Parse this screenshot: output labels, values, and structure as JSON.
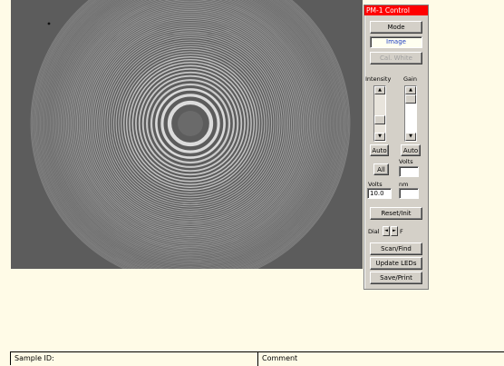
{
  "panel": {
    "title": "PM-1 Control",
    "mode_button": "Mode",
    "mode_value": "Image",
    "cal_white_button": "Cal. White",
    "intensity_label": "Intensity",
    "gain_label": "Gain",
    "auto_intensity_button": "Auto",
    "auto_gain_button": "Auto",
    "all_button": "All",
    "volts_label_right": "Volts",
    "volts_value_right": "",
    "volts_label_left": "Volts",
    "volts_value_left": "10.0",
    "nm_label": "nm",
    "nm_value": "",
    "reset_button": "Reset/Init",
    "dial_label": "Dial",
    "arrow_left": "◄",
    "arrow_right": "►",
    "dial_suffix": "F",
    "scan_button": "Scan/Find",
    "update_leds_button": "Update LEDs",
    "save_button": "Save/Print"
  },
  "footer": {
    "sample_id_label": "Sample ID:",
    "comment_label": "Comment"
  },
  "icons": {
    "up": "▲",
    "down": "▼"
  }
}
